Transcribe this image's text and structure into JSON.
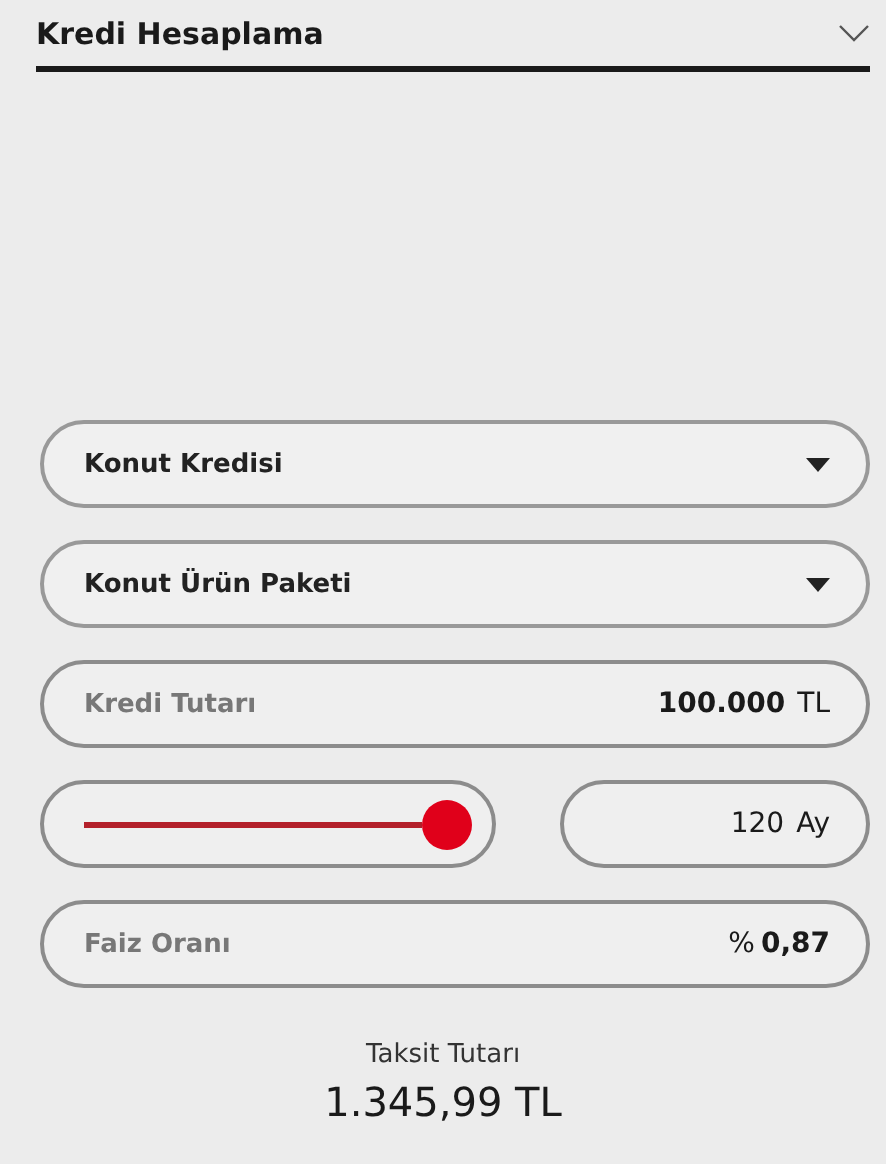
{
  "header": {
    "title": "Kredi Hesaplama",
    "expanded": true
  },
  "dropdowns": [
    {
      "value": "Konut Kredisi"
    },
    {
      "value": "Konut Ürün Paketi"
    }
  ],
  "amount": {
    "label": "Kredi Tutarı",
    "value": "100.000",
    "unit": "TL"
  },
  "term": {
    "value": "120",
    "unit": "Ay"
  },
  "rate": {
    "label": "Faiz Oranı",
    "unit": "%",
    "value": "0,87"
  },
  "result": {
    "label": "Taksit Tutarı",
    "value": "1.345,99 TL"
  }
}
